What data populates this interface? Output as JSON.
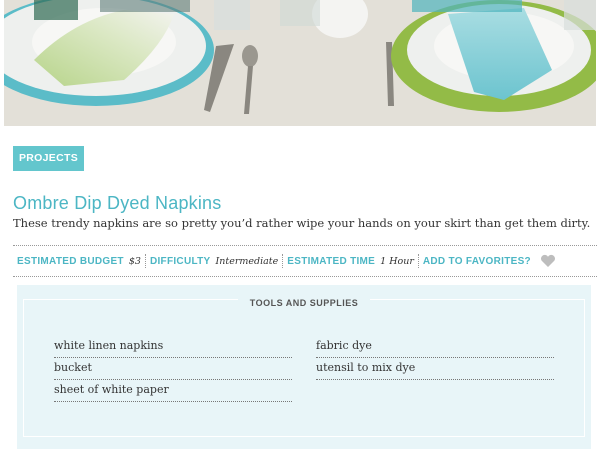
{
  "category_tag": "PROJECTS",
  "project": {
    "title": "Ombre Dip Dyed Napkins",
    "description": "These trendy napkins are so pretty you’d rather wipe your hands on your skirt than get them dirty."
  },
  "meta": {
    "budget_label": "ESTIMATED BUDGET",
    "budget_value": "$3",
    "difficulty_label": "DIFFICULTY",
    "difficulty_value": "Intermediate",
    "time_label": "ESTIMATED TIME",
    "time_value": "1 Hour",
    "favorites_label": "ADD TO FAVORITES?",
    "favorites_icon": "heart-icon"
  },
  "tools": {
    "title": "TOOLS AND SUPPLIES",
    "left_items": [
      "white linen napkins",
      "bucket",
      "sheet of white paper"
    ],
    "right_items": [
      "fabric dye",
      "utensil to mix dye"
    ]
  },
  "colors": {
    "accent": "#4cb6c4",
    "tag_bg": "#63c6cd",
    "panel_bg": "#e8f5f8"
  }
}
